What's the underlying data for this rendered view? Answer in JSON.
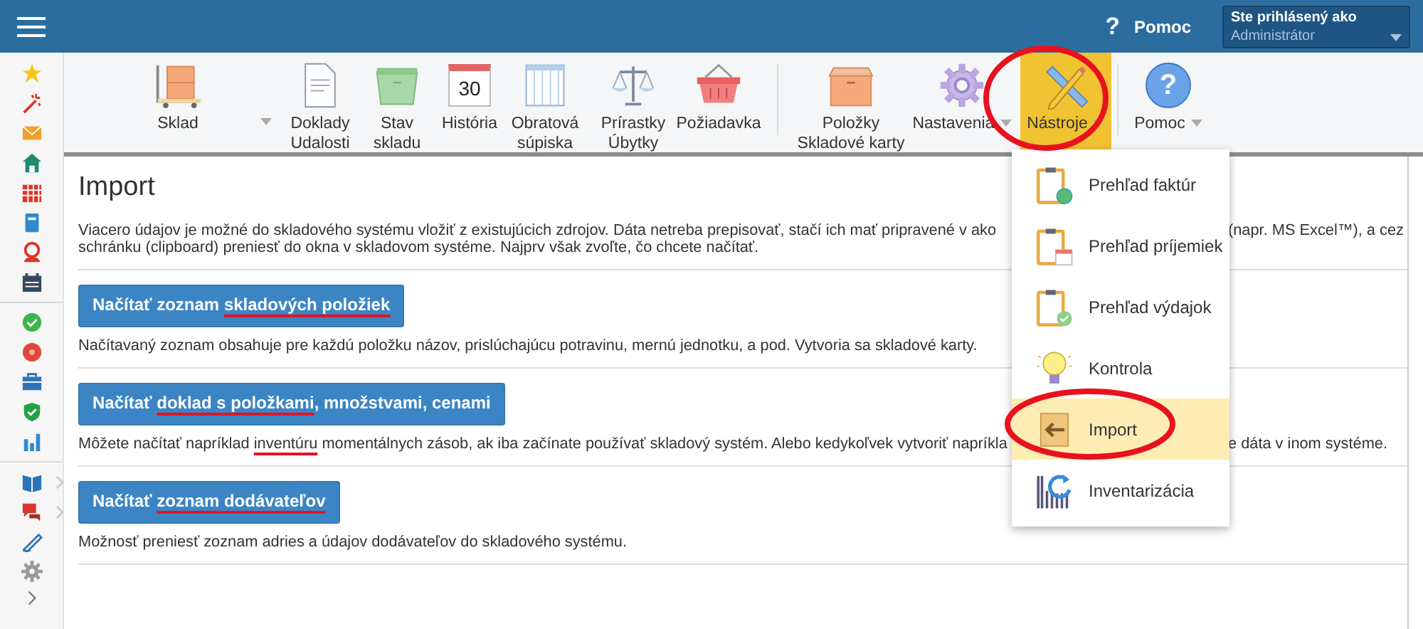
{
  "header": {
    "help_button": {
      "glyph": "?",
      "label": "Pomoc"
    },
    "user": {
      "caption": "Ste prihlásený ako",
      "name": "Administrátor"
    }
  },
  "toolbar": {
    "groups": [
      [
        {
          "kind": "split",
          "lines": [
            "Sklad"
          ],
          "has_menu": true,
          "selected": false
        },
        {
          "kind": "normal",
          "lines": [
            "Doklady",
            "Udalosti"
          ],
          "has_menu": false,
          "selected": false
        },
        {
          "kind": "normal",
          "lines": [
            "Stav",
            "skladu"
          ],
          "has_menu": false,
          "selected": false
        },
        {
          "kind": "normal",
          "lines": [
            "História"
          ],
          "has_menu": false,
          "selected": false,
          "icon_text": "30"
        },
        {
          "kind": "normal",
          "lines": [
            "Obratová",
            "súpiska"
          ],
          "has_menu": false,
          "selected": false
        },
        {
          "kind": "normal",
          "lines": [
            "Prírastky",
            "Úbytky"
          ],
          "has_menu": false,
          "selected": false
        },
        {
          "kind": "normal",
          "lines": [
            "Požiadavka"
          ],
          "has_menu": false,
          "selected": false
        }
      ],
      [
        {
          "kind": "normal",
          "lines": [
            "Položky",
            "Skladové karty"
          ],
          "has_menu": false,
          "selected": false
        },
        {
          "kind": "normal",
          "lines": [
            "Nastavenia"
          ],
          "has_menu": true,
          "selected": false
        },
        {
          "kind": "normal",
          "lines": [
            "Nástroje"
          ],
          "has_menu": true,
          "selected": true
        }
      ],
      [
        {
          "kind": "normal",
          "lines": [
            "Pomoc"
          ],
          "has_menu": true,
          "selected": false,
          "icon_text": "?"
        }
      ]
    ]
  },
  "page": {
    "title": "Import",
    "intro": [
      {
        "left": [
          {
            "text": "Viacero údajov je možné do skladového systému vložiť z existujúcich zdrojov. Dáta netreba prepisovať, stačí ich mať pripravené v ako",
            "marked": false
          }
        ],
        "right": [
          {
            "text": "(napr. MS Excel™), a cez",
            "marked": false
          }
        ]
      },
      {
        "left": [
          {
            "text": "schránku (clipboard) preniesť do okna v skladovom systéme. Najprv však zvoľte, čo chcete načítať.",
            "marked": false
          }
        ]
      }
    ],
    "sections": [
      {
        "button": [
          {
            "text": "Načítať zoznam ",
            "marked": false
          },
          {
            "text": "skladových položiek",
            "marked": true
          }
        ],
        "description": [
          {
            "left": [
              {
                "text": "Načítavaný zoznam obsahuje pre každú položku názov, prislúchajúcu potravinu, mernú jednotku, a pod. Vytvoria sa skladové karty.",
                "marked": false
              }
            ]
          }
        ]
      },
      {
        "button": [
          {
            "text": "Načítať ",
            "marked": false
          },
          {
            "text": "doklad s položkami",
            "marked": true
          },
          {
            "text": ", množstvami, cenami",
            "marked": false
          }
        ],
        "description": [
          {
            "left": [
              {
                "text": "Môžete načítať napríklad ",
                "marked": false
              },
              {
                "text": "inventúru",
                "marked": true
              },
              {
                "text": " momentálnych zásob, ak iba začínate používať skladový systém. Alebo kedykoľvek vytvoriť napríkla",
                "marked": false
              }
            ],
            "right": [
              {
                "text": "e dáta v inom systéme.",
                "marked": false
              }
            ]
          }
        ]
      },
      {
        "button": [
          {
            "text": "Načítať ",
            "marked": false
          },
          {
            "text": "zoznam dodávateľov",
            "marked": true
          }
        ],
        "description": [
          {
            "left": [
              {
                "text": "Možnosť preniesť zoznam adries a údajov dodávateľov do skladového systému.",
                "marked": false
              }
            ]
          }
        ]
      }
    ]
  },
  "tools_menu": {
    "items": [
      {
        "label": "Prehľad faktúr",
        "selected": false
      },
      {
        "label": "Prehľad príjemiek",
        "selected": false
      },
      {
        "label": "Prehľad výdajok",
        "selected": false
      },
      {
        "label": "Kontrola",
        "selected": false
      },
      {
        "label": "Import",
        "selected": true
      },
      {
        "label": "Inventarizácia",
        "selected": false
      }
    ]
  }
}
